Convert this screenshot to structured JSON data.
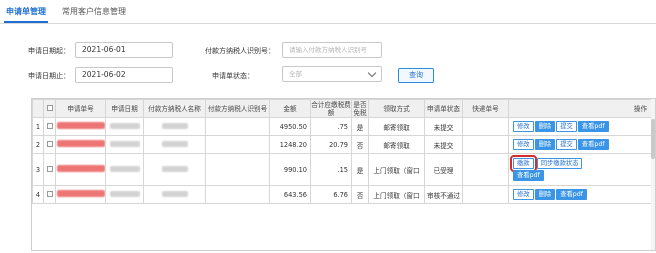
{
  "tabs": [
    {
      "label": "申请单管理",
      "active": true
    },
    {
      "label": "常用客户信息管理",
      "active": false
    }
  ],
  "form": {
    "start_date": {
      "label": "申请日期起：",
      "value": "2021-06-01"
    },
    "end_date": {
      "label": "申请日期止：",
      "value": "2021-06-02"
    },
    "taxpayer_id": {
      "label": "付款方纳税人识别号：",
      "placeholder": "请输入付款方纳税人识别号"
    },
    "status": {
      "label": "申请单状态：",
      "value": "全部"
    },
    "query_button": "查询"
  },
  "table": {
    "headers": [
      "",
      "申请单号",
      "申请日期",
      "付款方纳税人名称",
      "付款方纳税人识别号",
      "金额",
      "合计应缴税费额",
      "是否免税",
      "领取方式",
      "申请单状态",
      "快递单号",
      "操作"
    ],
    "rows": [
      {
        "index": "1",
        "amount": "4950.50",
        "tax": ".75",
        "exempt": "是",
        "method": "邮寄领取",
        "status": "未提交",
        "ops": [
          "修改",
          "删除",
          "提交",
          "查看pdf"
        ]
      },
      {
        "index": "2",
        "amount": "1248.20",
        "tax": "20.79",
        "exempt": "否",
        "method": "邮寄领取",
        "status": "未提交",
        "ops": [
          "修改",
          "删除",
          "提交",
          "查看pdf"
        ]
      },
      {
        "index": "3",
        "amount": "990.10",
        "tax": ".15",
        "exempt": "是",
        "method": "上门领取（窗口",
        "status": "已受理",
        "ops": [
          "缴款",
          "同步缴款状态",
          "查看pdf"
        ]
      },
      {
        "index": "4",
        "amount": "643.56",
        "tax": "6.76",
        "exempt": "否",
        "method": "上门领取（窗口",
        "status": "审核不通过",
        "ops": [
          "修改",
          "删除",
          "查看pdf"
        ]
      }
    ]
  },
  "colors": {
    "accent": "#1f6fd1",
    "button": "#3a95e6",
    "highlight": "#d42b2b",
    "redacted": "#ec5d5d"
  }
}
